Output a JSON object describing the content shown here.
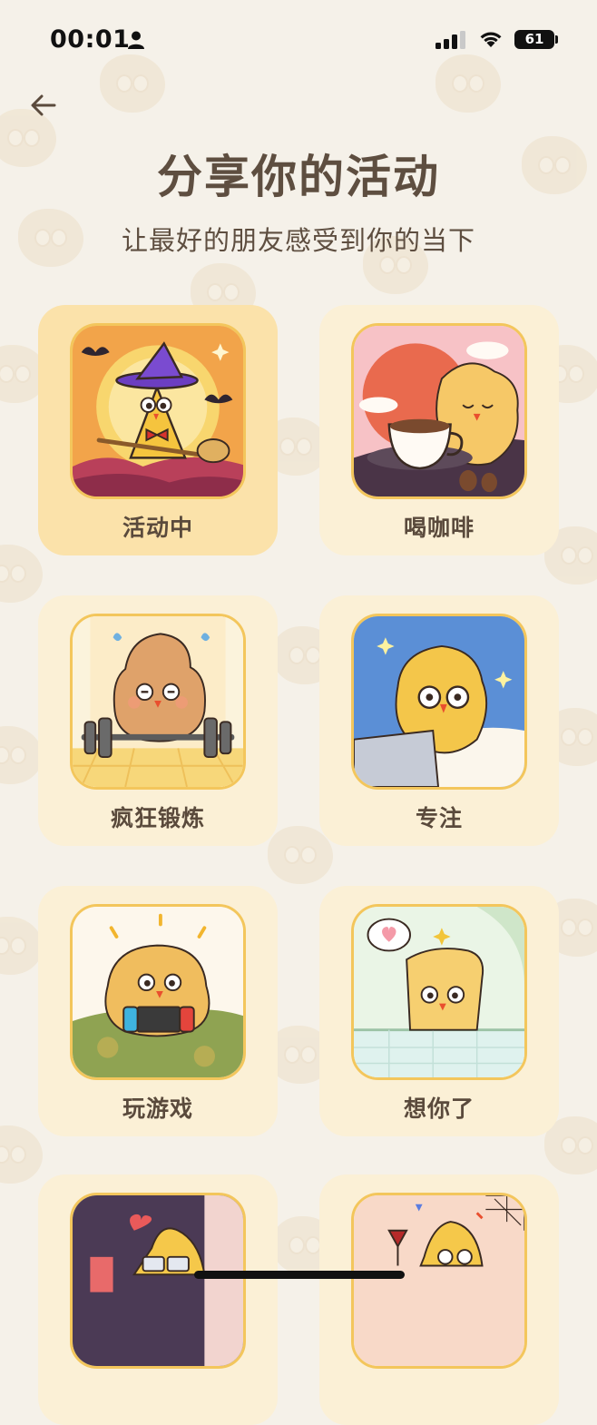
{
  "status_bar": {
    "time": "00:01",
    "battery": "61",
    "icons": [
      "person-icon",
      "signal-icon",
      "wifi-icon",
      "battery-icon"
    ]
  },
  "header": {
    "back_icon": "arrow-left-icon",
    "title": "分享你的活动",
    "subtitle": "让最好的朋友感受到你的当下"
  },
  "activities": [
    {
      "label": "活动中",
      "selected": true
    },
    {
      "label": "喝咖啡",
      "selected": false
    },
    {
      "label": "疯狂锻炼",
      "selected": false
    },
    {
      "label": "专注",
      "selected": false
    },
    {
      "label": "玩游戏",
      "selected": false
    },
    {
      "label": "想你了",
      "selected": false
    },
    {
      "label": "",
      "selected": false
    },
    {
      "label": "",
      "selected": false
    }
  ],
  "colors": {
    "background": "#f5f1e9",
    "card": "#fbf0d6",
    "card_selected": "#fbe2aa",
    "thumb_border": "#f3c65c",
    "text": "#5e4e40"
  }
}
